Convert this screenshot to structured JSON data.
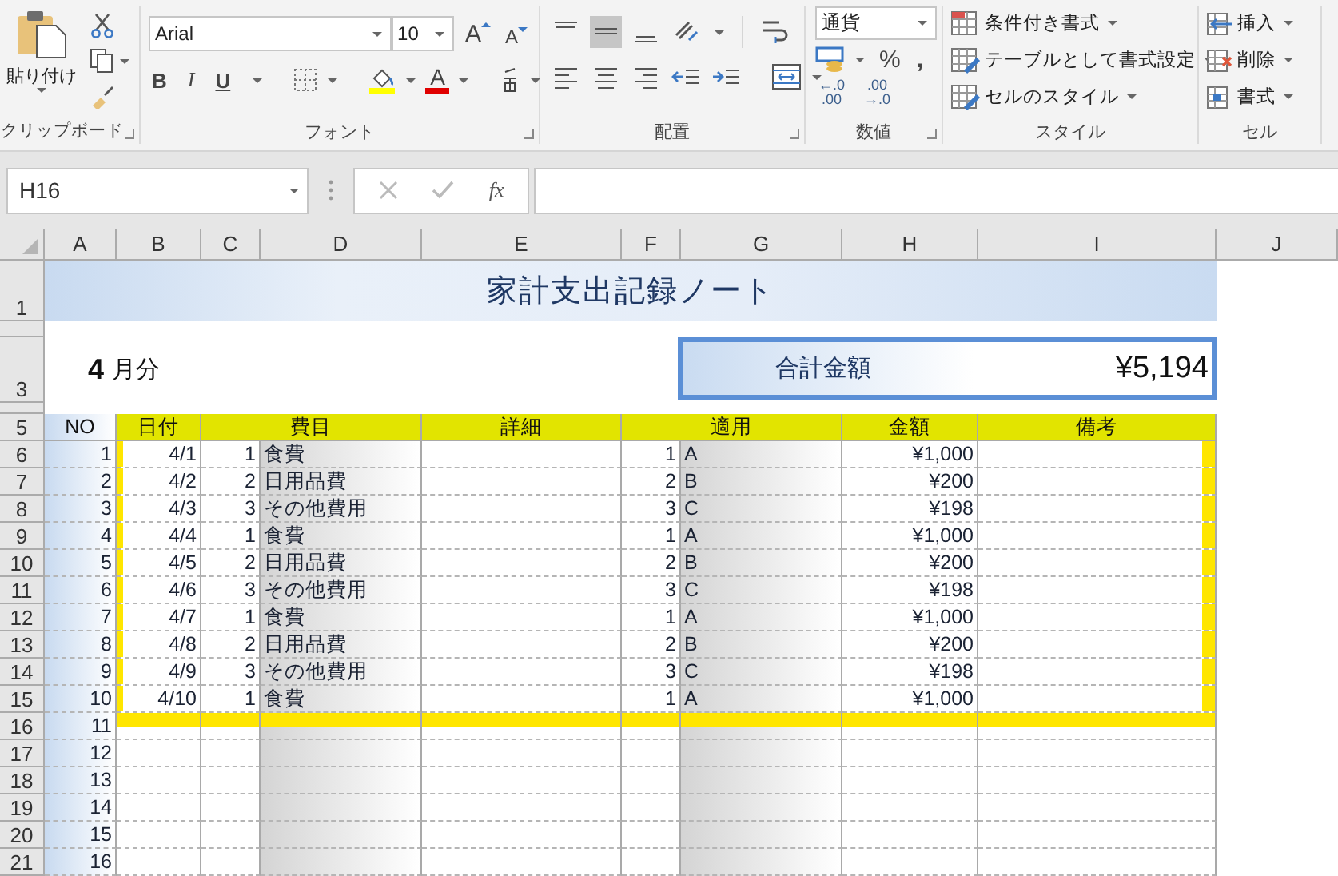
{
  "ribbon": {
    "clipboard": {
      "paste_label": "貼り付け",
      "label": "クリップボード"
    },
    "font": {
      "font_name": "Arial",
      "font_size": "10",
      "grow_label": "A",
      "shrink_label": "A",
      "format_buttons": [
        {
          "kind": "bold",
          "label": "B"
        },
        {
          "kind": "italic",
          "label": "I"
        },
        {
          "kind": "underline",
          "label": "U"
        }
      ],
      "font_color_label": "A",
      "label": "フォント"
    },
    "alignment": {
      "label": "配置"
    },
    "number": {
      "format": "通貨",
      "percent": "%",
      "comma": ",",
      "decimal_buttons": [
        {
          "top": "←.0",
          "bottom": ".00"
        },
        {
          "top": ".00",
          "bottom": "→.0"
        }
      ],
      "label": "数値"
    },
    "styles": {
      "items": [
        "条件付き書式",
        "テーブルとして書式設定",
        "セルのスタイル"
      ],
      "label": "スタイル"
    },
    "cells": {
      "items": [
        "挿入",
        "削除",
        "書式"
      ],
      "label": "セル"
    }
  },
  "formula_bar": {
    "name_box": "H16",
    "fx": "fx"
  },
  "columns": [
    "A",
    "B",
    "C",
    "D",
    "E",
    "F",
    "G",
    "H",
    "I",
    "J"
  ],
  "row_numbers": [
    "1",
    "3",
    "5",
    "6",
    "7",
    "8",
    "9",
    "10",
    "11",
    "12",
    "13",
    "14",
    "15",
    "16",
    "17",
    "18",
    "19",
    "20",
    "21"
  ],
  "sheet": {
    "title": "家計支出記録ノート",
    "month": "4",
    "month_suffix": "月分",
    "total_label": "合計金額",
    "total_value": "¥5,194",
    "headers": [
      "NO",
      "日付",
      "費目",
      "詳細",
      "適用",
      "金額",
      "備考"
    ],
    "rows": [
      {
        "no": "1",
        "date": "4/1",
        "category_code": "1",
        "category": "食費",
        "detail_code": "1",
        "detail": "A",
        "amount": "¥1,000"
      },
      {
        "no": "2",
        "date": "4/2",
        "category_code": "2",
        "category": "日用品費",
        "detail_code": "2",
        "detail": "B",
        "amount": "¥200"
      },
      {
        "no": "3",
        "date": "4/3",
        "category_code": "3",
        "category": "その他費用",
        "detail_code": "3",
        "detail": "C",
        "amount": "¥198"
      },
      {
        "no": "4",
        "date": "4/4",
        "category_code": "1",
        "category": "食費",
        "detail_code": "1",
        "detail": "A",
        "amount": "¥1,000"
      },
      {
        "no": "5",
        "date": "4/5",
        "category_code": "2",
        "category": "日用品費",
        "detail_code": "2",
        "detail": "B",
        "amount": "¥200"
      },
      {
        "no": "6",
        "date": "4/6",
        "category_code": "3",
        "category": "その他費用",
        "detail_code": "3",
        "detail": "C",
        "amount": "¥198"
      },
      {
        "no": "7",
        "date": "4/7",
        "category_code": "1",
        "category": "食費",
        "detail_code": "1",
        "detail": "A",
        "amount": "¥1,000"
      },
      {
        "no": "8",
        "date": "4/8",
        "category_code": "2",
        "category": "日用品費",
        "detail_code": "2",
        "detail": "B",
        "amount": "¥200"
      },
      {
        "no": "9",
        "date": "4/9",
        "category_code": "3",
        "category": "その他費用",
        "detail_code": "3",
        "detail": "C",
        "amount": "¥198"
      },
      {
        "no": "10",
        "date": "4/10",
        "category_code": "1",
        "category": "食費",
        "detail_code": "1",
        "detail": "A",
        "amount": "¥1,000"
      },
      {
        "no": "11"
      },
      {
        "no": "12"
      },
      {
        "no": "13"
      },
      {
        "no": "14"
      },
      {
        "no": "15"
      },
      {
        "no": "16"
      }
    ]
  }
}
